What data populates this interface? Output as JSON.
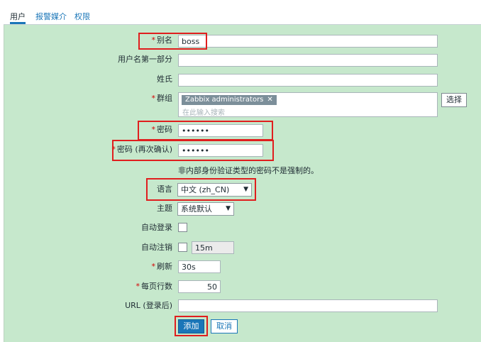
{
  "tabs": [
    {
      "label": "用户",
      "active": true
    },
    {
      "label": "报警媒介",
      "active": false
    },
    {
      "label": "权限",
      "active": false
    }
  ],
  "form": {
    "alias": {
      "label": "别名",
      "required": true,
      "value": "boss"
    },
    "name": {
      "label": "用户名第一部分",
      "value": ""
    },
    "surname": {
      "label": "姓氏",
      "value": ""
    },
    "groups": {
      "label": "群组",
      "required": true,
      "selected": "Zabbix administrators",
      "placeholder": "在此输入搜索",
      "select_button": "选择"
    },
    "password": {
      "label": "密码",
      "required": true,
      "value": "••••••"
    },
    "password_confirm": {
      "label": "密码 (再次确认)",
      "required": true,
      "value": "••••••"
    },
    "password_note": "非内部身份验证类型的密码不是强制的。",
    "language": {
      "label": "语言",
      "value": "中文 (zh_CN)"
    },
    "theme": {
      "label": "主题",
      "value": "系统默认"
    },
    "autologin": {
      "label": "自动登录",
      "checked": false
    },
    "autologout": {
      "label": "自动注销",
      "checked": false,
      "value": "15m"
    },
    "refresh": {
      "label": "刷新",
      "required": true,
      "value": "30s"
    },
    "rows_per_page": {
      "label": "每页行数",
      "required": true,
      "value": "50"
    },
    "url": {
      "label": "URL (登录后)",
      "value": ""
    }
  },
  "buttons": {
    "add": "添加",
    "cancel": "取消"
  },
  "colors": {
    "highlight": "#e01e1e",
    "panel_bg": "#c6e8cc",
    "primary": "#1a76b8"
  }
}
